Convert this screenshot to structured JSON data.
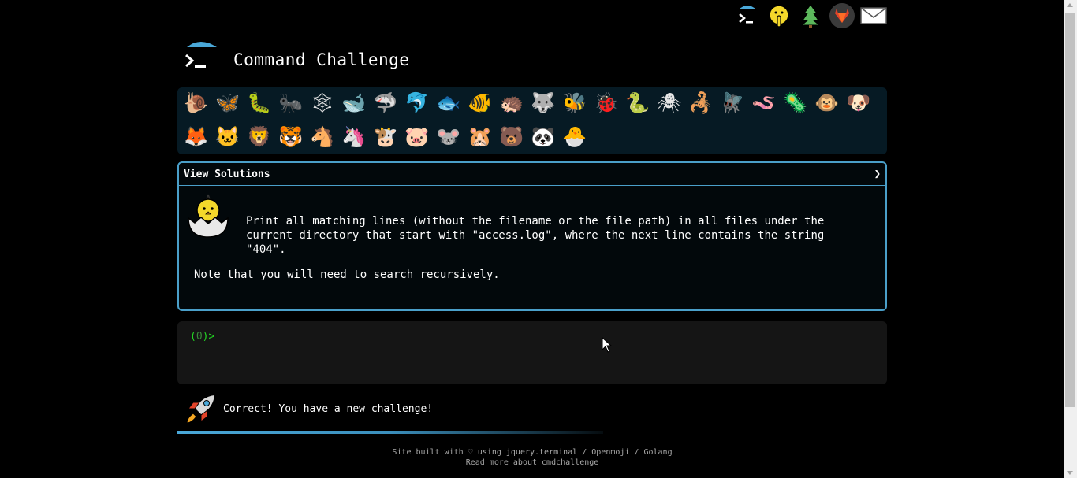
{
  "header": {
    "title": "Command Challenge"
  },
  "top_icons": [
    "terminal-logo-icon",
    "shushing-face-icon",
    "tree-icon",
    "gitlab-icon",
    "envelope-icon"
  ],
  "animals_row1": [
    "🐌",
    "🦋",
    "🐛",
    "🐜",
    "🕸",
    "🐋",
    "🦈",
    "🐬",
    "🐟",
    "🐠",
    "🦔",
    "🐺",
    "🐝",
    "🐞",
    "🐍",
    "🕷",
    "🦂",
    "🪰",
    "🪱",
    "🦠",
    "🐵",
    "🐶"
  ],
  "animals_row2": [
    "🦊",
    "🐱",
    "🦁",
    "🐯",
    "🐴",
    "🦄",
    "🐮",
    "🐷",
    "🐭",
    "🐹",
    "🐻",
    "🐼",
    "🐣"
  ],
  "challenge": {
    "view_solutions": "View Solutions",
    "chevron": "❯",
    "description": "Print all matching lines (without the filename or the file path) in all files under the current directory that start with \"access.log\", where the next line contains the string \"404\".",
    "note": "Note that you will need to search recursively."
  },
  "terminal": {
    "prompt_open": "(",
    "prompt_num": "0",
    "prompt_close": ")>"
  },
  "status": {
    "message": "Correct! You have a new challenge!",
    "progress": 0.6
  },
  "footer": {
    "line1": "Site built with ♡ using jquery.terminal / Openmoji / Golang",
    "line2": "Read more about cmdchallenge"
  }
}
